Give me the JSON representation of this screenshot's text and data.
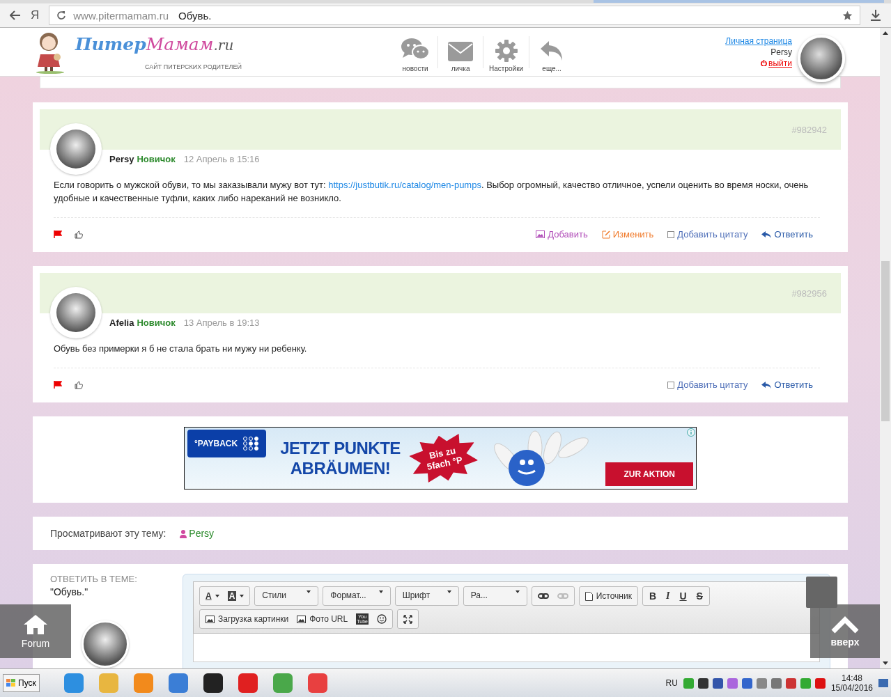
{
  "browser": {
    "yandex": "Я",
    "url_host": "www.pitermamam.ru",
    "url_title": "Обувь."
  },
  "header": {
    "logo_parts": [
      "Питер",
      "Мамам",
      ".ru"
    ],
    "subtitle": "САЙТ ПИТЕРСКИХ РОДИТЕЛЕЙ",
    "nav": [
      {
        "kind": "chat",
        "label": "новости"
      },
      {
        "kind": "mail",
        "label": "личка"
      },
      {
        "kind": "gear",
        "label": "Настройки"
      },
      {
        "kind": "reply",
        "label": "еще..."
      }
    ],
    "user": {
      "link": "Личная страница",
      "name": "Persy",
      "logout": "выйти"
    }
  },
  "posts": [
    {
      "author": "Persy",
      "rank": "Новичок",
      "date": "12 Апрель в 15:16",
      "number": "#982942",
      "text_before": "Если говорить о мужской обуви, то мы заказывали мужу вот тут: ",
      "link": "https://justbutik.ru/catalog/men-pumps",
      "text_after": ". Выбор огромный, качество отличное, успели оценить во время носки, очень удобные и качественные туфли, каких либо нареканий не возникло.",
      "actions": [
        {
          "kind": "image",
          "label": "Добавить"
        },
        {
          "kind": "edit",
          "label": "Изменить"
        },
        {
          "kind": "quote",
          "label": "Добавить цитату"
        },
        {
          "kind": "reply",
          "label": "Ответить"
        }
      ]
    },
    {
      "author": "Afelia",
      "rank": "Новичок",
      "date": "13 Апрель в 19:13",
      "number": "#982956",
      "text_before": "Обувь без примерки я б не стала брать ни мужу ни ребенку.",
      "actions": [
        {
          "kind": "quote",
          "label": "Добавить цитату"
        },
        {
          "kind": "reply",
          "label": "Ответить"
        }
      ]
    }
  ],
  "ad": {
    "brand": "°PAYBACK",
    "headline": [
      "JETZT PUNKTE",
      "ABRÄUMEN!"
    ],
    "burst": [
      "Bis zu",
      "5fach °P"
    ],
    "cta": "ZUR AKTION"
  },
  "viewers": {
    "label": "Просматривают эту тему:",
    "users": [
      "Persy"
    ]
  },
  "reply": {
    "label": "ОТВЕТИТЬ В ТЕМЕ:",
    "topic": "\"Обувь.\"",
    "toolbar": [
      [
        {
          "kind": "color",
          "label": "A"
        },
        {
          "kind": "bgcolor",
          "label": "A"
        }
      ],
      [
        {
          "kind": "dropdown",
          "label": "Стили"
        }
      ],
      [
        {
          "kind": "dropdown",
          "label": "Формат..."
        }
      ],
      [
        {
          "kind": "dropdown",
          "label": "Шрифт"
        }
      ],
      [
        {
          "kind": "dropdown",
          "label": "Ра..."
        }
      ],
      [
        {
          "kind": "link",
          "disabled": false
        },
        {
          "kind": "unlink",
          "disabled": true
        }
      ],
      [
        {
          "kind": "source",
          "label": "Источник"
        }
      ],
      [
        {
          "kind": "bold",
          "label": "B"
        },
        {
          "kind": "italic",
          "label": "I"
        },
        {
          "kind": "underline",
          "label": "U"
        },
        {
          "kind": "strike",
          "label": "S"
        }
      ]
    ],
    "toolbar2": [
      [
        {
          "kind": "upload",
          "label": "Загрузка картинки"
        },
        {
          "kind": "photo",
          "label": "Фото URL"
        },
        {
          "kind": "youtube",
          "label": "You Tube"
        },
        {
          "kind": "smiley"
        }
      ],
      [
        {
          "kind": "maximize"
        }
      ]
    ]
  },
  "floating": {
    "forum": "Forum",
    "up": "вверх"
  },
  "taskbar": {
    "start": "Пуск",
    "lang": "RU",
    "time": "14:48",
    "date": "15/04/2016"
  }
}
